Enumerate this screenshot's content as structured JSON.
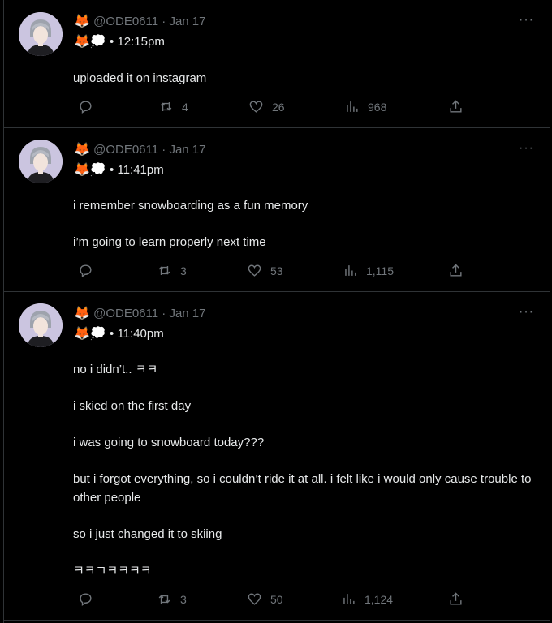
{
  "tweets": [
    {
      "handle": "@ODE0611",
      "date": "Jan 17",
      "emoji_top": "🦊",
      "emoji_row": "🦊💭",
      "time": "12:15pm",
      "lines": [
        "uploaded it on instagram"
      ],
      "retweets": "4",
      "likes": "26",
      "views": "968"
    },
    {
      "handle": "@ODE0611",
      "date": "Jan 17",
      "emoji_top": "🦊",
      "emoji_row": "🦊💭",
      "time": "11:41pm",
      "lines": [
        "i remember snowboarding as a fun memory",
        "i’m going to learn properly next time"
      ],
      "retweets": "3",
      "likes": "53",
      "views": "1,115"
    },
    {
      "handle": "@ODE0611",
      "date": "Jan 17",
      "emoji_top": "🦊",
      "emoji_row": "🦊💭",
      "time": "11:40pm",
      "lines": [
        "no i didn’t.. ㅋㅋ",
        "i skied on the first day",
        "i was going to snowboard today???",
        "but i forgot everything, so i couldn’t ride it at all. i felt like i would only cause trouble to other people",
        "so i just changed it to skiing",
        "ㅋㅋㄱㅋㅋㅋㅋ"
      ],
      "retweets": "3",
      "likes": "50",
      "views": "1,124"
    }
  ],
  "separator": "·",
  "bullet": "•",
  "more_label": "···"
}
